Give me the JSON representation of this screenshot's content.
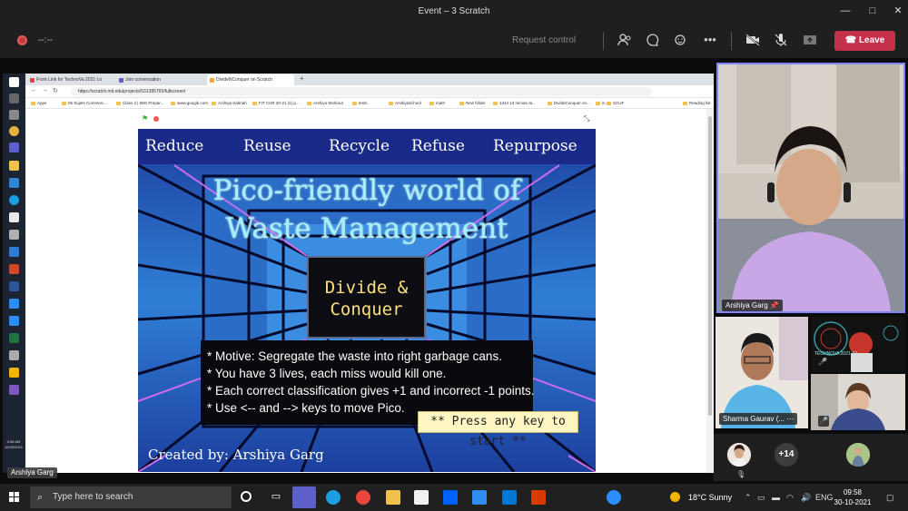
{
  "window": {
    "title": "Event – 3 Scratch"
  },
  "meeting": {
    "timer": "--:--",
    "request_control": "Request control",
    "leave_label": "Leave"
  },
  "browser": {
    "tabs": [
      {
        "label": "Front Link for TechnoVa 2021 Lo"
      },
      {
        "label": "Join conversation"
      },
      {
        "label": "DivideNConquer on Scratch"
      }
    ],
    "url": "https://scratch.mit.edu/projects/531385760/fullscreen/",
    "bookmarks": [
      "Apps",
      "06 Sujets Commerc...",
      "Class 3 | IMO Prepar...",
      "www.google.com",
      "Arshiya Sabnah",
      "FIT CUR 20-21 (1).p...",
      "Arshiya Workout",
      "tests",
      "ArshiyaSchool",
      "math",
      "New folder",
      "1344 13 minute at...",
      "DivideConquer on...",
      "in",
      "SCUF",
      "Reading list"
    ]
  },
  "scratch": {
    "menu": [
      "Reduce",
      "Reuse",
      "Recycle",
      "Refuse",
      "Repurpose"
    ],
    "title_line1": "Pico-friendly world of",
    "title_line2": "Waste Management",
    "divide_line1": "Divide &",
    "divide_line2": "Conquer",
    "rules": [
      "* Motive: Segregate  the waste into right garbage cans.",
      "* You have 3 lives, each miss would kill one.",
      "* Each correct classification gives +1 and incorrect -1 points.",
      "* Use <-- and --> keys to move Pico."
    ],
    "press_key": "** Press any key to start **",
    "credit": "Created by: Arshiya Garg"
  },
  "presenter_label": "Arshiya Garg",
  "participants": {
    "main_name": "Arshiya Garg",
    "tile1_name": "Sharma Gaurav (...",
    "more_count": "+14",
    "tile2_logo_text": "TECHNOVA 2021-22"
  },
  "left_strip": {
    "time": "9:58 AM",
    "date": "10/30/2021",
    "lang": "ENG"
  },
  "taskbar": {
    "search_placeholder": "Type here to search",
    "weather": "18°C  Sunny",
    "lang": "ENG",
    "time": "09:58",
    "date": "30-10-2021"
  },
  "colors": {
    "leave": "#c4314b",
    "active_speaker_border": "#7f85f5",
    "stage_header": "#1a2a88",
    "title_text": "#9ff3ff"
  }
}
